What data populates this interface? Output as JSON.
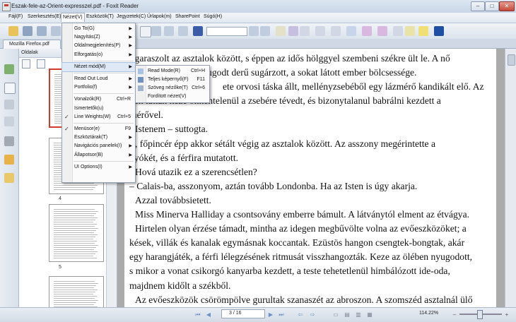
{
  "window": {
    "title": "Eszak-fele-az-Orient-expresszel.pdf - Foxit Reader"
  },
  "menubar": [
    "Fájl(F)",
    "Szerkesztés(E)",
    "Nézet(V)",
    "Eszközök(T)",
    "Jegyzetek(C)",
    "Űrlapok(m)",
    "SharePoint",
    "Súgó(H)"
  ],
  "tab": {
    "label": "Mozilla Firefox.pdf"
  },
  "panel": {
    "title": "Oldalak",
    "page_numbers": [
      "4",
      "5"
    ]
  },
  "view_menu": [
    {
      "label": "Go To(G)",
      "submenu": true
    },
    {
      "label": "Nagyítás(Z)",
      "submenu": true
    },
    {
      "label": "Oldalmegjelenítés(P)",
      "submenu": true
    },
    {
      "label": "Elforgatás(o)",
      "submenu": true
    },
    {
      "sep": true
    },
    {
      "label": "Nézet mód(M)",
      "submenu": true,
      "highlight": true
    },
    {
      "sep": true
    },
    {
      "label": "Read Out Loud",
      "submenu": true
    },
    {
      "label": "Portfolio(f)",
      "submenu": true
    },
    {
      "sep": true
    },
    {
      "label": "Vonalzók(R)",
      "shortcut": "Ctrl+R"
    },
    {
      "label": "Ismertetők(u)"
    },
    {
      "label": "Line Weights(W)",
      "shortcut": "Ctrl+5",
      "checked": true
    },
    {
      "sep": true
    },
    {
      "label": "Menüsor(e)",
      "shortcut": "F9",
      "checked": true
    },
    {
      "label": "Eszköztárak(T)",
      "submenu": true
    },
    {
      "label": "Navigációs panelek(I)",
      "submenu": true
    },
    {
      "label": "Állapotsor(B)",
      "submenu": true
    },
    {
      "sep": true
    },
    {
      "label": "UI Options(I)",
      "submenu": true
    }
  ],
  "mode_submenu": [
    {
      "label": "Read Mode(R)",
      "shortcut": "Ctrl+H"
    },
    {
      "label": "Teljes képernyő(F)",
      "shortcut": "F11"
    },
    {
      "label": "Szöveg nézőke(T)",
      "shortcut": "Ctrl+6"
    },
    {
      "label": "Fordított nézet(V)"
    }
  ],
  "document": {
    "paragraphs": [
      "tigaraszolt az asztalok között, s éppen az idős hölggyel szembeni székre ült le. A nő",
      "ről nyugodt derű sugárzott, a sokat látott ember bölcsessége.",
      "ete orvosi táska állt, mellényzsebéből egy lázmérő kandikált elő. Az",
      "gen lattan keze önkéntelenül a zsebére tévedt, és bizonytalanul babrálni kezdett a",
      "mérővel.",
      "Istenem – suttogta.",
      ", főpincér épp akkor sétált végig az asztalok között. Az asszony megérintette a",
      "nyókét, és a férfira mutatott.",
      "Hová utazik ez a szerencsétlen?",
      "– Calais-ba, asszonyom, aztán tovább Londonba. Ha az Isten is úgy akarja.",
      "Azzal továbbsietett.",
      "Miss Minerva Halliday a csontsovány emberre bámult. A látványtól elment az étvágya.",
      "Hirtelen olyan érzése támadt, mintha az idegen megbűvölte volna az evőeszközöket; a",
      "kések, villák és kanalak egymásnak koccantak. Ezüstös hangon csengtek-bongtak, akár",
      "egy harangjáték, a férfi lélegzésének ritmusát visszhangozták. Keze az ölében nyugodott,",
      "s mikor a vonat csikorgó kanyarba kezdett, a teste tehetetlenül himbálózott ide-oda,",
      "majdnem kidőlt a székből.",
      "Az evőeszközök csörömpölve gurultak szanaszét az abroszon. A szomszéd asztalnál ülő"
    ]
  },
  "statusbar": {
    "page": "3 / 16",
    "zoom": "114.22%"
  }
}
